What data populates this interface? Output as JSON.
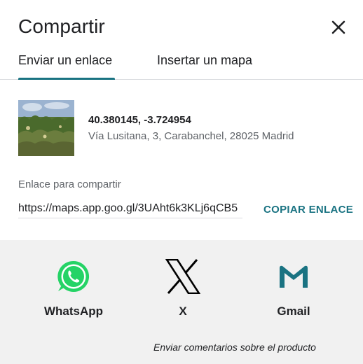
{
  "dialog": {
    "title": "Compartir",
    "close_icon": "close-icon"
  },
  "tabs": [
    {
      "label": "Enviar un enlace",
      "active": true
    },
    {
      "label": "Insertar un mapa",
      "active": false
    }
  ],
  "place": {
    "coordinates": "40.380145, -3.724954",
    "address": "Vía Lusitana, 3, Carabanchel, 28025 Madrid"
  },
  "link": {
    "label": "Enlace para compartir",
    "value": "https://maps.app.goo.gl/3UAht6k3KLj6qCB5",
    "copy_label": "COPIAR ENLACE"
  },
  "share": {
    "targets": [
      {
        "label": "WhatsApp",
        "icon": "whatsapp-icon",
        "color": "#25d366"
      },
      {
        "label": "X",
        "icon": "x-icon",
        "color": "#000000"
      },
      {
        "label": "Gmail",
        "icon": "gmail-icon",
        "color": "#1a7382"
      }
    ],
    "feedback": "Enviar comentarios sobre el producto"
  },
  "colors": {
    "accent": "#1a7382",
    "share_background": "#f1f1f1",
    "divider": "#dadce0"
  }
}
